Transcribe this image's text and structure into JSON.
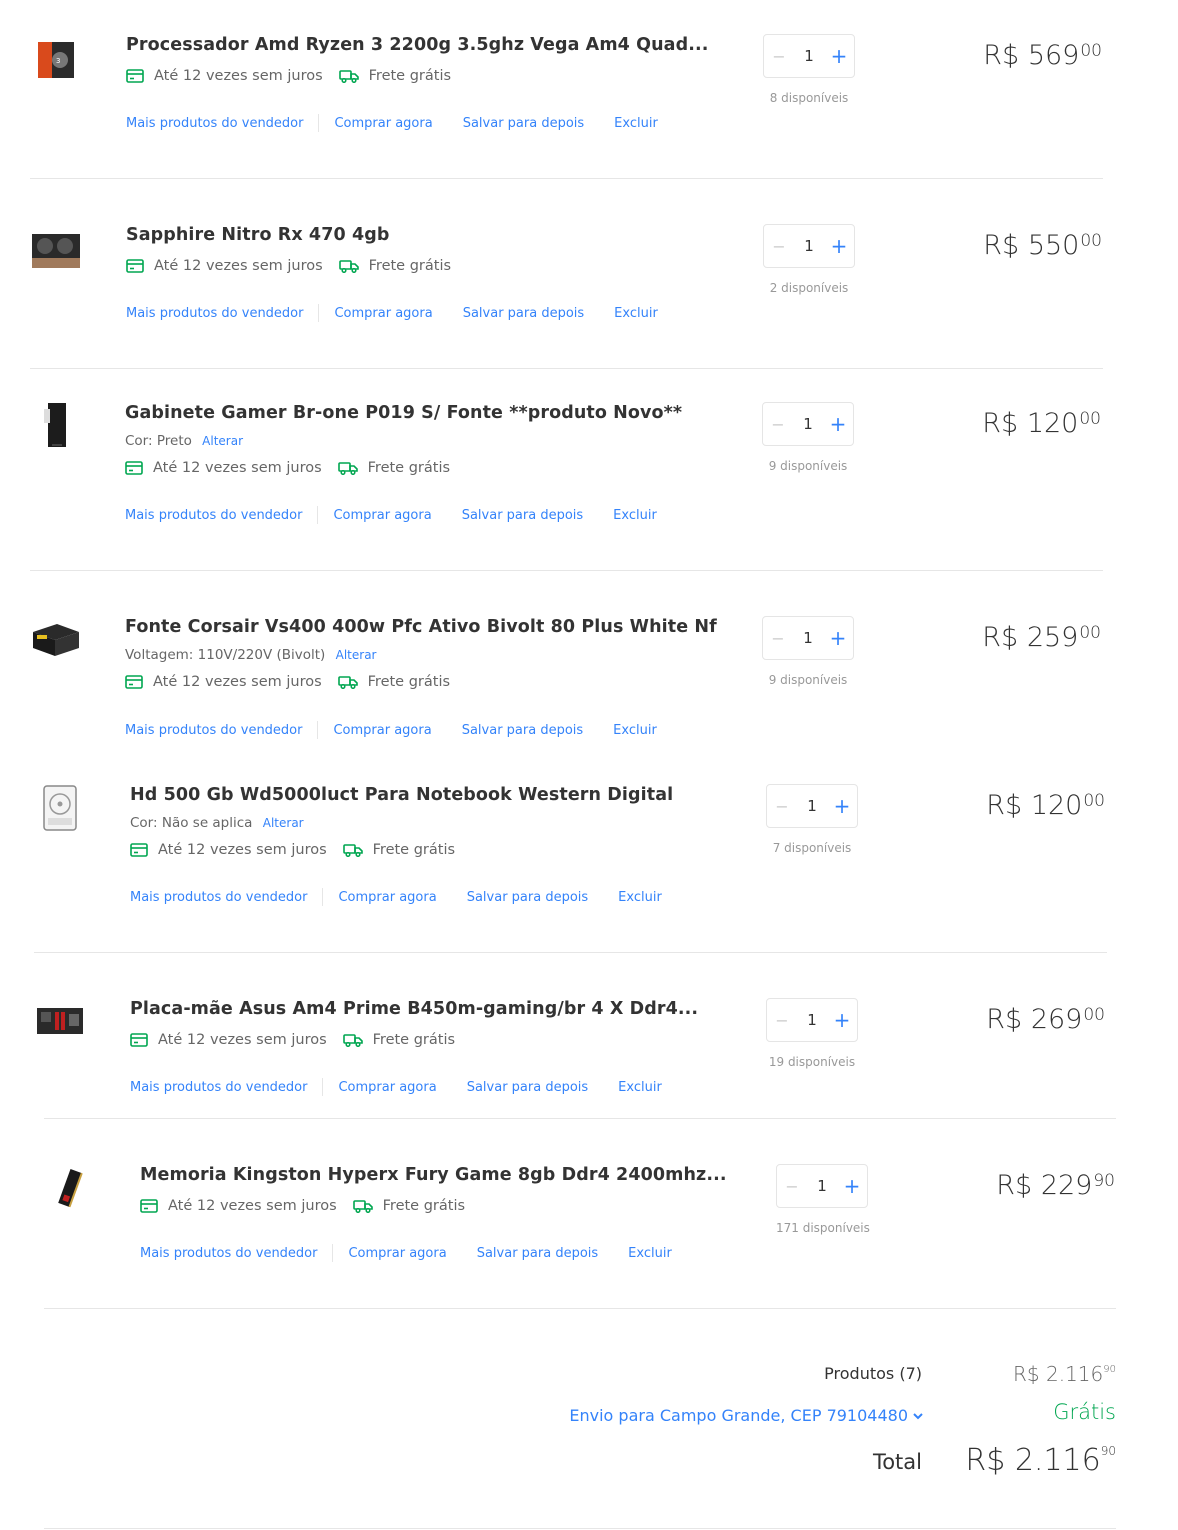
{
  "items": [
    {
      "title": "Processador Amd Ryzen 3 2200g 3.5ghz Vega Am4 Quad...",
      "variant_label": "",
      "variant_value": "",
      "alterar": "",
      "installments": "Até 12 vezes sem juros",
      "shipping": "Frete grátis",
      "actions": [
        "Mais produtos do vendedor",
        "Comprar agora",
        "Salvar para depois",
        "Excluir"
      ],
      "qty": "1",
      "minus": "−",
      "plus": "+",
      "available": "8 disponíveis",
      "currency": "R$",
      "price_int": "569",
      "price_cents": "00",
      "thumb_icon": "cpu-box-icon"
    },
    {
      "title": "Sapphire Nitro Rx 470 4gb",
      "variant_label": "",
      "variant_value": "",
      "alterar": "",
      "installments": "Até 12 vezes sem juros",
      "shipping": "Frete grátis",
      "actions": [
        "Mais produtos do vendedor",
        "Comprar agora",
        "Salvar para depois",
        "Excluir"
      ],
      "qty": "1",
      "minus": "−",
      "plus": "+",
      "available": "2 disponíveis",
      "currency": "R$",
      "price_int": "550",
      "price_cents": "00",
      "thumb_icon": "gpu-card-icon"
    },
    {
      "title": "Gabinete Gamer Br-one P019 S/ Fonte **produto Novo**",
      "variant_label": "Cor:",
      "variant_value": "Preto",
      "alterar": "Alterar",
      "installments": "Até 12 vezes sem juros",
      "shipping": "Frete grátis",
      "actions": [
        "Mais produtos do vendedor",
        "Comprar agora",
        "Salvar para depois",
        "Excluir"
      ],
      "qty": "1",
      "minus": "−",
      "plus": "+",
      "available": "9 disponíveis",
      "currency": "R$",
      "price_int": "120",
      "price_cents": "00",
      "thumb_icon": "pc-case-icon"
    },
    {
      "title": "Fonte Corsair Vs400 400w Pfc Ativo Bivolt 80 Plus White Nf",
      "variant_label": "Voltagem:",
      "variant_value": "110V/220V (Bivolt)",
      "alterar": "Alterar",
      "installments": "Até 12 vezes sem juros",
      "shipping": "Frete grátis",
      "actions": [
        "Mais produtos do vendedor",
        "Comprar agora",
        "Salvar para depois",
        "Excluir"
      ],
      "qty": "1",
      "minus": "−",
      "plus": "+",
      "available": "9 disponíveis",
      "currency": "R$",
      "price_int": "259",
      "price_cents": "00",
      "thumb_icon": "power-supply-icon"
    },
    {
      "title": "Hd 500 Gb Wd5000luct Para Notebook Western Digital",
      "variant_label": "Cor:",
      "variant_value": "Não se aplica",
      "alterar": "Alterar",
      "installments": "Até 12 vezes sem juros",
      "shipping": "Frete grátis",
      "actions": [
        "Mais produtos do vendedor",
        "Comprar agora",
        "Salvar para depois",
        "Excluir"
      ],
      "qty": "1",
      "minus": "−",
      "plus": "+",
      "available": "7 disponíveis",
      "currency": "R$",
      "price_int": "120",
      "price_cents": "00",
      "thumb_icon": "hard-drive-icon"
    },
    {
      "title": "Placa-mãe Asus Am4 Prime B450m-gaming/br 4 X Ddr4...",
      "variant_label": "",
      "variant_value": "",
      "alterar": "",
      "installments": "Até 12 vezes sem juros",
      "shipping": "Frete grátis",
      "actions": [
        "Mais produtos do vendedor",
        "Comprar agora",
        "Salvar para depois",
        "Excluir"
      ],
      "qty": "1",
      "minus": "−",
      "plus": "+",
      "available": "19 disponíveis",
      "currency": "R$",
      "price_int": "269",
      "price_cents": "00",
      "thumb_icon": "motherboard-icon"
    },
    {
      "title": "Memoria Kingston Hyperx Fury Game 8gb Ddr4 2400mhz...",
      "variant_label": "",
      "variant_value": "",
      "alterar": "",
      "installments": "Até 12 vezes sem juros",
      "shipping": "Frete grátis",
      "actions": [
        "Mais produtos do vendedor",
        "Comprar agora",
        "Salvar para depois",
        "Excluir"
      ],
      "qty": "1",
      "minus": "−",
      "plus": "+",
      "available": "171 disponíveis",
      "currency": "R$",
      "price_int": "229",
      "price_cents": "90",
      "thumb_icon": "ram-stick-icon"
    }
  ],
  "summary": {
    "products_label": "Produtos (7)",
    "products_currency": "R$",
    "products_int": "2.116",
    "products_cents": "90",
    "shipping_label": "Envio para Campo Grande, CEP 79104480",
    "shipping_value": "Grátis",
    "total_label": "Total",
    "total_currency": "R$",
    "total_int": "2.116",
    "total_cents": "90"
  },
  "colors": {
    "link": "#3483fa",
    "green": "#00a650",
    "text": "#333333",
    "muted": "#999999"
  }
}
